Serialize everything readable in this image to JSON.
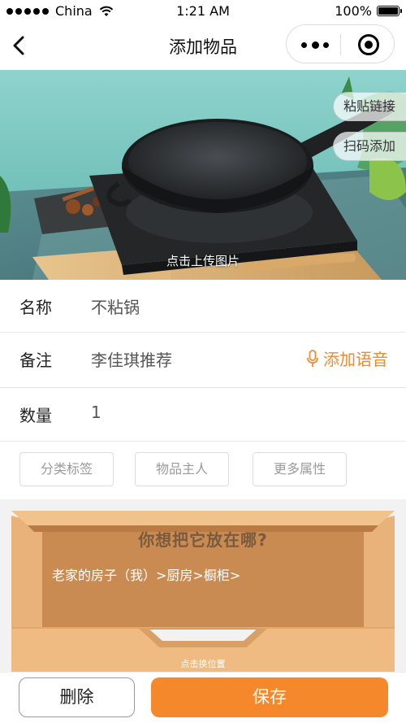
{
  "status_bar": {
    "carrier": "China",
    "time": "1:21 AM",
    "battery": "100%"
  },
  "nav": {
    "title": "添加物品"
  },
  "hero": {
    "link_button": "粘贴链接",
    "scan_button": "扫码添加",
    "upload_caption": "点击上传图片"
  },
  "form": {
    "name": {
      "label": "名称",
      "value": "不粘锅"
    },
    "note": {
      "label": "备注",
      "value": "李佳琪推荐",
      "voice_button": "添加语音"
    },
    "quantity": {
      "label": "数量",
      "value": "1"
    }
  },
  "tags": [
    "分类标签",
    "物品主人",
    "更多属性"
  ],
  "location": {
    "prompt": "你想把它放在哪?",
    "path": "老家的房子（我）>厨房>橱柜>",
    "hint": "点击换位置"
  },
  "actions": {
    "delete": "删除",
    "save": "保存"
  },
  "colors": {
    "accent": "#f5882a",
    "voice": "#f08a2e",
    "box_wood": "#e9b27a"
  }
}
